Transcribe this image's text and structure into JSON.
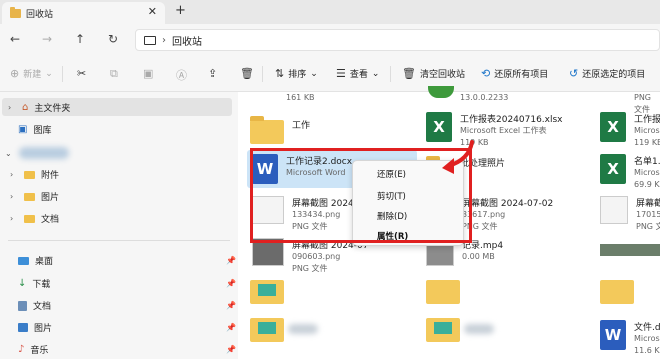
{
  "window": {
    "tab_title": "回收站",
    "new_tab": "+",
    "close": "✕"
  },
  "nav": {
    "back": "←",
    "forward": "→",
    "up": "↑",
    "refresh": "↻",
    "address": "回收站"
  },
  "toolbar": {
    "new": "新建",
    "sort": "排序",
    "view": "查看",
    "empty": "清空回收站",
    "restore_all": "还原所有项目",
    "restore_selected": "还原选定的项目"
  },
  "sidebar": {
    "home": "主文件夹",
    "gallery": "图库",
    "attachments": "附件",
    "pictures": "图片",
    "documents": "文档",
    "desktop": "桌面",
    "downloads": "下载",
    "docs2": "文档",
    "pictures2": "图片",
    "music": "音乐"
  },
  "files": {
    "top_size": "161 KB",
    "top_mid": "13.0.0.2233",
    "top_right": "PNG 文件",
    "folder_work": "工作",
    "xlsx_name": "工作报表20240716.xlsx",
    "xlsx_type": "Microsoft Excel 工作表",
    "xlsx_size": "119 KB",
    "right1_name": "工作报",
    "right1_type": "Microsoft",
    "right1_size": "119 KB",
    "docx_name": "工作记录2.docx",
    "docx_type": "Microsoft Word",
    "batch_name": "批处理照片",
    "right2_name": "名单1.",
    "right2_type": "Microsoft",
    "right2_size": "69.9 K",
    "shot1_name": "屏幕截图 2024-07",
    "shot1_sub": "133434.png",
    "shot1_type": "PNG 文件",
    "shot2_name": "屏幕截图 2024-07-02",
    "shot2_sub": "33617.png",
    "shot2_type": "PNG 文件",
    "right3_name": "屏幕截",
    "right3_sub": "170159",
    "right3_type": "PNG 文",
    "shot3_name": "屏幕截图 2024-07",
    "shot3_sub": "090603.png",
    "shot3_type": "PNG 文件",
    "mp4_name": "记录.mp4",
    "mp4_size": "0.00 MB",
    "bottom_name": "文件.d",
    "bottom_type": "Microsoft",
    "bottom_size": "11.6 K"
  },
  "context_menu": {
    "restore": "还原(E)",
    "cut": "剪切(T)",
    "delete": "删除(D)",
    "properties": "属性(R)"
  },
  "colors": {
    "highlight": "#e02020",
    "selection": "#cce4f7",
    "excel": "#1f7a45",
    "word": "#2b5dbd"
  }
}
